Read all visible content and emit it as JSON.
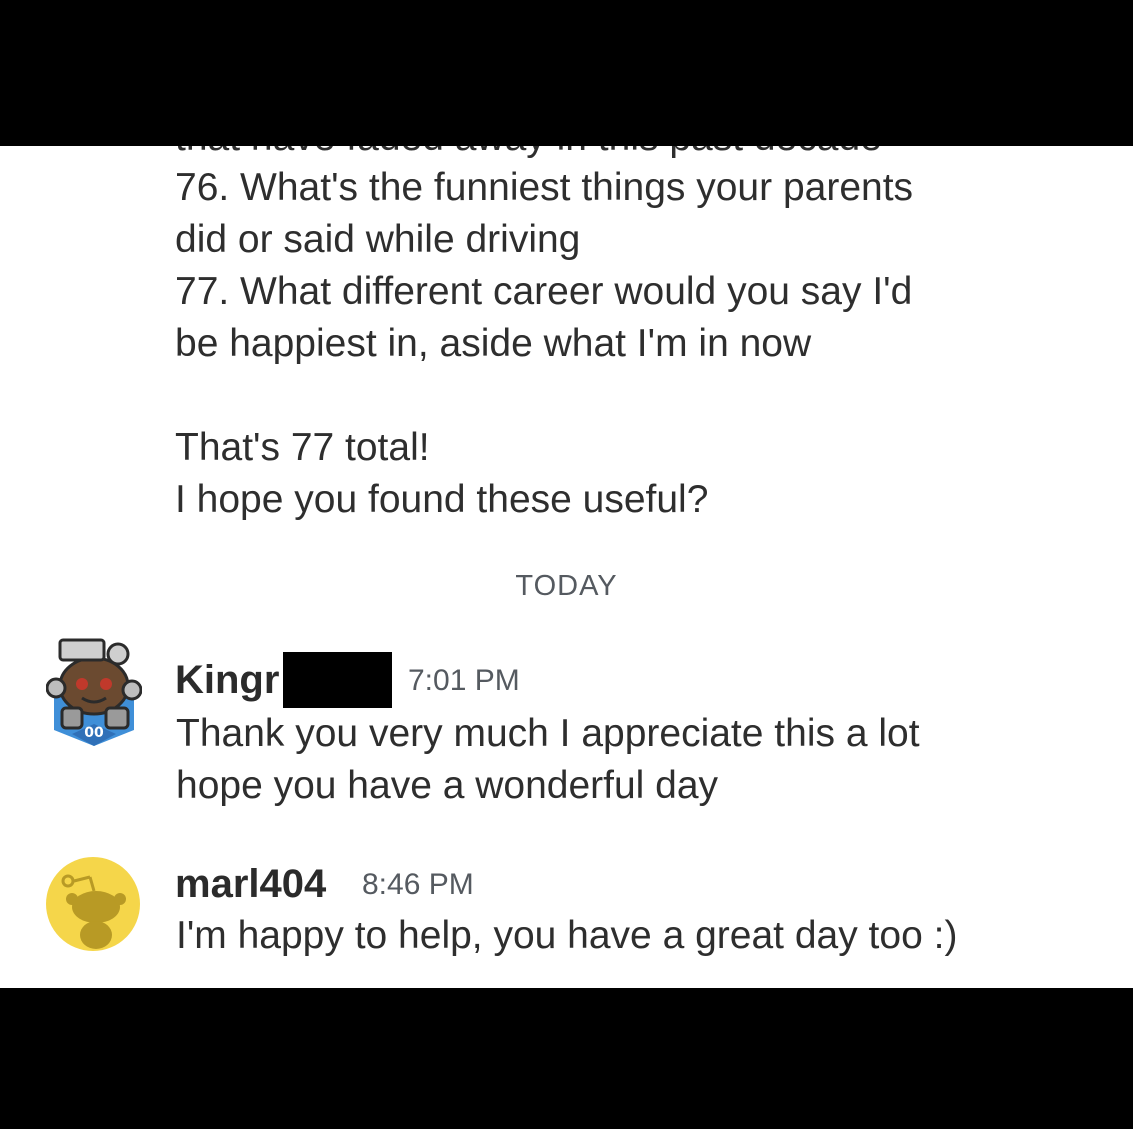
{
  "thread": {
    "cut_line": "that have faded away in this past decade",
    "prev_message": {
      "lines": [
        "76. What's the funniest things your parents",
        "did or said while driving",
        "77. What different career would you say I'd",
        "be happiest in, aside what I'm in now",
        "That's 77 total!",
        "I hope you found these useful?"
      ]
    },
    "separator": "TODAY",
    "messages": [
      {
        "author": "Kingr",
        "time": "7:01 PM",
        "lines": [
          "Thank you very much I appreciate this a lot",
          "hope you have a wonderful day"
        ],
        "avatar_icon": "snoo-football-avatar-icon",
        "avatar_badge": "00"
      },
      {
        "author": "marl404",
        "time": "8:46 PM",
        "lines": [
          "I'm happy to help, you have a great day too :)"
        ],
        "avatar_icon": "snoo-default-avatar-icon"
      }
    ]
  },
  "colors": {
    "background": "#ffffff",
    "text": "#2e2e2e",
    "muted": "#555a60",
    "avatar_yellow": "#f5d64a",
    "avatar_blue": "#3f8fd8"
  }
}
